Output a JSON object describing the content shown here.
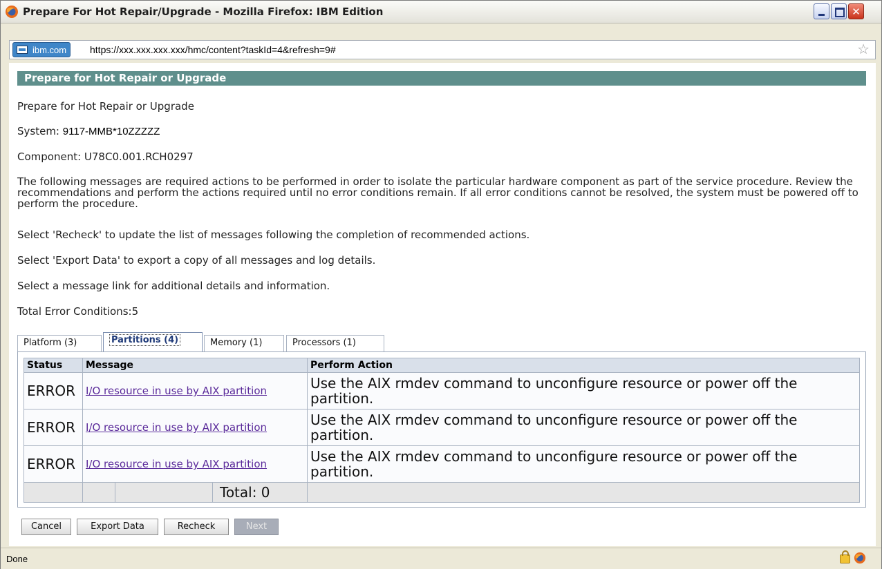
{
  "window": {
    "title": "Prepare For Hot Repair/Upgrade - Mozilla Firefox: IBM Edition"
  },
  "urlbar": {
    "site_label": "ibm.com",
    "url": "https://xxx.xxx.xxx.xxx/hmc/content?taskId=4&refresh=9#"
  },
  "panel": {
    "header": "Prepare for Hot Repair or Upgrade",
    "heading_line": "Prepare for Hot Repair or Upgrade",
    "system_label": "System:",
    "system_value": "9117-MMB*10ZZZZZ",
    "component_line": "Component: U78C0.001.RCH0297",
    "description": "The following messages are required actions to be performed in order to isolate the particular hardware component as part of the service procedure. Review the recommendations and perform the actions required until no error conditions remain. If all error conditions cannot be resolved, the system must be powered off to perform the procedure.",
    "recheck_note": "Select 'Recheck' to update the list of messages following the completion of recommended actions.",
    "export_note": "Select 'Export Data' to export a copy of all messages and log details.",
    "link_note": "Select a message link for additional details and information.",
    "total_errors": "Total Error Conditions:5"
  },
  "tabs": [
    {
      "label": "Platform (3)"
    },
    {
      "label": "Partitions (4)"
    },
    {
      "label": "Memory (1)"
    },
    {
      "label": "Processors (1)"
    }
  ],
  "table": {
    "headers": [
      "Status",
      "Message",
      "Perform Action"
    ],
    "rows": [
      {
        "status": "ERROR",
        "message": "I/O resource in use by AIX partition",
        "action": "Use the AIX rmdev command to unconfigure resource or power off the partition."
      },
      {
        "status": "ERROR",
        "message": "I/O resource in use by AIX partition",
        "action": "Use the AIX rmdev command to unconfigure resource or power off the partition."
      },
      {
        "status": "ERROR",
        "message": "I/O resource in use by AIX partition",
        "action": "Use the AIX rmdev command to unconfigure resource or power off the partition."
      }
    ],
    "total": "Total: 0"
  },
  "buttons": {
    "cancel": "Cancel",
    "export": "Export Data",
    "recheck": "Recheck",
    "next": "Next"
  },
  "status": {
    "text": "Done"
  }
}
